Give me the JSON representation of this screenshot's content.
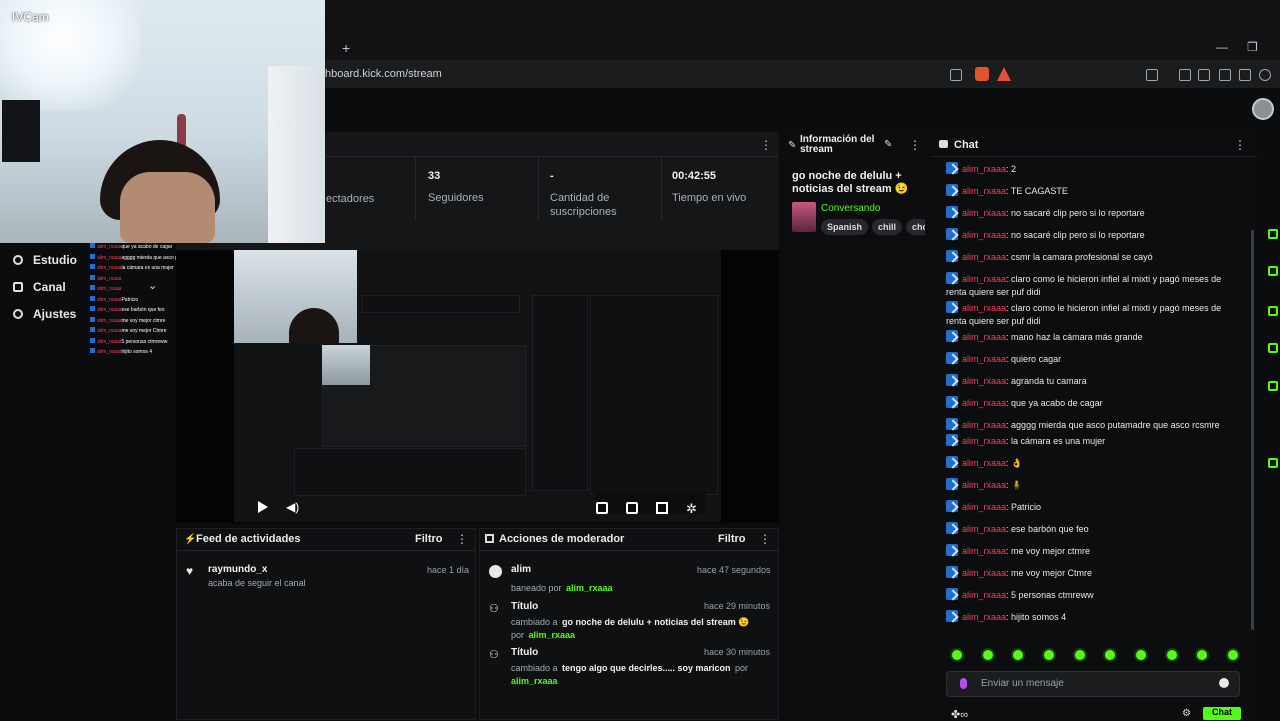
{
  "camera": {
    "label": "IVCam"
  },
  "browser": {
    "url": "hboard.kick.com/stream",
    "new_tab_label": "+",
    "minimize_label": "—",
    "restore_label": "❐"
  },
  "sidebar": {
    "items": [
      {
        "label": "Estudio",
        "icon": "studio-icon"
      },
      {
        "label": "Canal",
        "icon": "channel-icon"
      },
      {
        "label": "Ajustes",
        "icon": "settings-icon"
      }
    ]
  },
  "stats": {
    "items": [
      {
        "value": "",
        "label": "ectadores"
      },
      {
        "value": "33",
        "label": "Seguidores"
      },
      {
        "value": "-",
        "label": "Cantidad de suscripciones"
      },
      {
        "value": "00:42:55",
        "label": "Tiempo en vivo"
      }
    ]
  },
  "stream_info": {
    "title": "Información del stream",
    "stream_title": "go noche de delulu + noticias del stream 😉",
    "category": "Conversando",
    "tags": [
      "Spanish",
      "chill",
      "cho"
    ]
  },
  "activity_feed": {
    "title": "Feed de actividades",
    "filter_label": "Filtro",
    "items": [
      {
        "user": "raymundo_x",
        "text": "acaba de seguir el canal",
        "time": "hace 1 día"
      }
    ]
  },
  "mod_actions": {
    "title": "Acciones de moderador",
    "filter_label": "Filtro",
    "items": [
      {
        "title": "alim",
        "prefix": "baneado por",
        "value": "alim_rxaaa",
        "suffix": "",
        "by": "",
        "time": "hace 47 segundos"
      },
      {
        "title": "Título",
        "prefix": "cambiado a",
        "value": "go noche de delulu + noticias del stream 😉",
        "suffix": "por",
        "by": "alim_rxaaa",
        "time": "hace 29 minutos"
      },
      {
        "title": "Título",
        "prefix": "cambiado a",
        "value": "tengo algo que decirles..... soy maricon",
        "suffix": "por",
        "by": "alim_rxaaa",
        "time": "hace 30 minutos"
      }
    ]
  },
  "chat": {
    "title": "Chat",
    "input_placeholder": "Enviar un mensaje",
    "send_label": "Chat",
    "messages": [
      {
        "user": "alim_rxaaa",
        "text": "2"
      },
      {
        "user": "alim_rxaaa",
        "text": "TE CAGASTE"
      },
      {
        "user": "alim_rxaaa",
        "text": "no sacaré clip pero si lo reportare"
      },
      {
        "user": "alim_rxaaa",
        "text": "no sacaré clip pero si lo reportare"
      },
      {
        "user": "alim_rxaaa",
        "text": "csmr la camara profesional se cayó"
      },
      {
        "user": "alim_rxaaa",
        "text": "claro como le hicieron infiel al mixti y pagó meses de renta quiere ser puf didi"
      },
      {
        "user": "alim_rxaaa",
        "text": "claro como le hicieron infiel al mixti y pagó meses de renta quiere ser puf didi"
      },
      {
        "user": "alim_rxaaa",
        "text": "mano haz la cámara más grande"
      },
      {
        "user": "alim_rxaaa",
        "text": "quiero cagar"
      },
      {
        "user": "alim_rxaaa",
        "text": "agranda tu camara"
      },
      {
        "user": "alim_rxaaa",
        "text": "que ya acabo de cagar"
      },
      {
        "user": "alim_rxaaa",
        "text": "agggg mierda que asco putamadre que asco rcsmre"
      },
      {
        "user": "alim_rxaaa",
        "text": "la cámara es una mujer"
      },
      {
        "user": "alim_rxaaa",
        "text": "👌"
      },
      {
        "user": "alim_rxaaa",
        "text": "🧍"
      },
      {
        "user": "alim_rxaaa",
        "text": "Patricio"
      },
      {
        "user": "alim_rxaaa",
        "text": "ese barbón que feo"
      },
      {
        "user": "alim_rxaaa",
        "text": "me voy mejor ctmre"
      },
      {
        "user": "alim_rxaaa",
        "text": "me voy mejor Ctmre"
      },
      {
        "user": "alim_rxaaa",
        "text": "5 personas ctmreww"
      },
      {
        "user": "alim_rxaaa",
        "text": "hijito somos 4"
      }
    ],
    "overlay_messages": [
      "que ya acabo de cagar",
      "agggg mierda que asco putamadre que asco",
      "la cámara es una mujer",
      "",
      "",
      "Patricio",
      "ese barbón que feo",
      "me voy mejor ctmre",
      "me voy mejor Ctmre",
      "5 personas ctmreww",
      "hijito somos 4"
    ],
    "overlay_user": "alim_rxaaa"
  },
  "colors": {
    "accent": "#53fc18",
    "username": "#ff3b57",
    "panel_bg": "#151618"
  }
}
